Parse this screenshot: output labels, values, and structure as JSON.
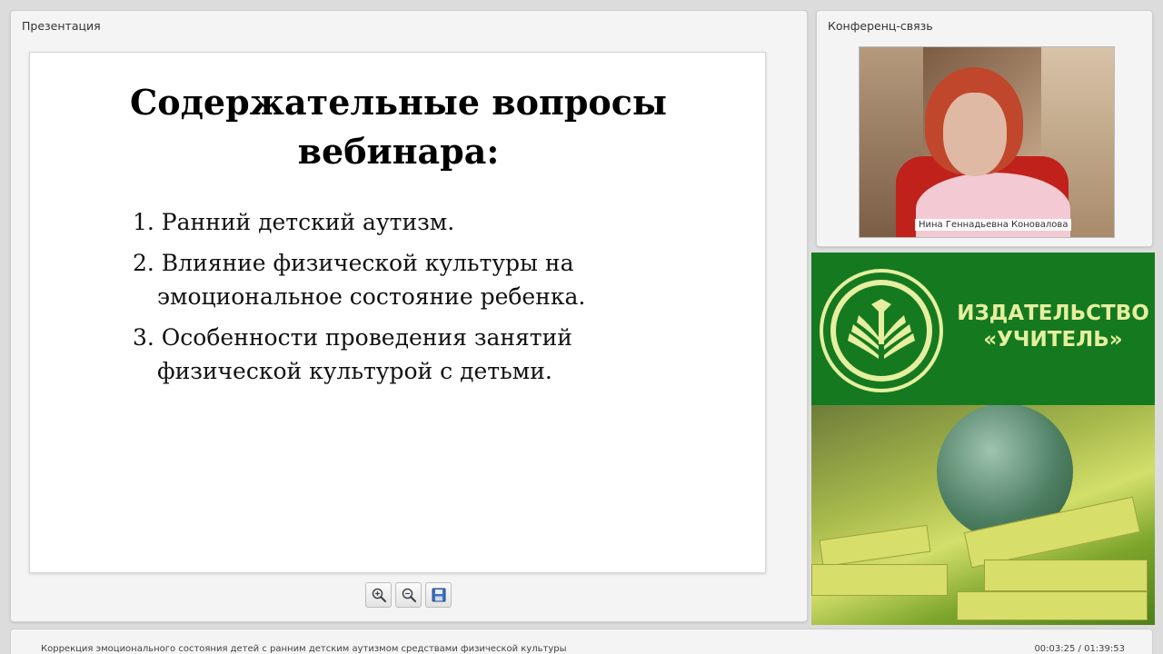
{
  "presentation": {
    "panel_title": "Презентация",
    "slide": {
      "title_line1": "Содержательные вопросы",
      "title_line2": "вебинара:",
      "items": [
        "1. Ранний детский аутизм.",
        "2. Влияние физической культуры на эмоциональное состояние ребенка.",
        "3. Особенности проведения занятий физической культурой с детьми."
      ]
    },
    "toolbar": {
      "zoom_in_icon": "zoom-in-icon",
      "zoom_out_icon": "zoom-out-icon",
      "save_icon": "save-icon"
    }
  },
  "conference": {
    "panel_title": "Конференц-связь",
    "speaker_name": "Нина Геннадьевна Коновалова"
  },
  "ad": {
    "publisher_line1": "ИЗДАТЕЛЬСТВО",
    "publisher_line2": "«УЧИТЕЛЬ»",
    "brand_color": "#157a1f",
    "text_color": "#e6efa0"
  },
  "status": {
    "webinar_title": "Коррекция эмоционального состояния детей с ранним детским аутизмом средствами физической культуры",
    "time": "00:03:25 / 01:39:53"
  }
}
